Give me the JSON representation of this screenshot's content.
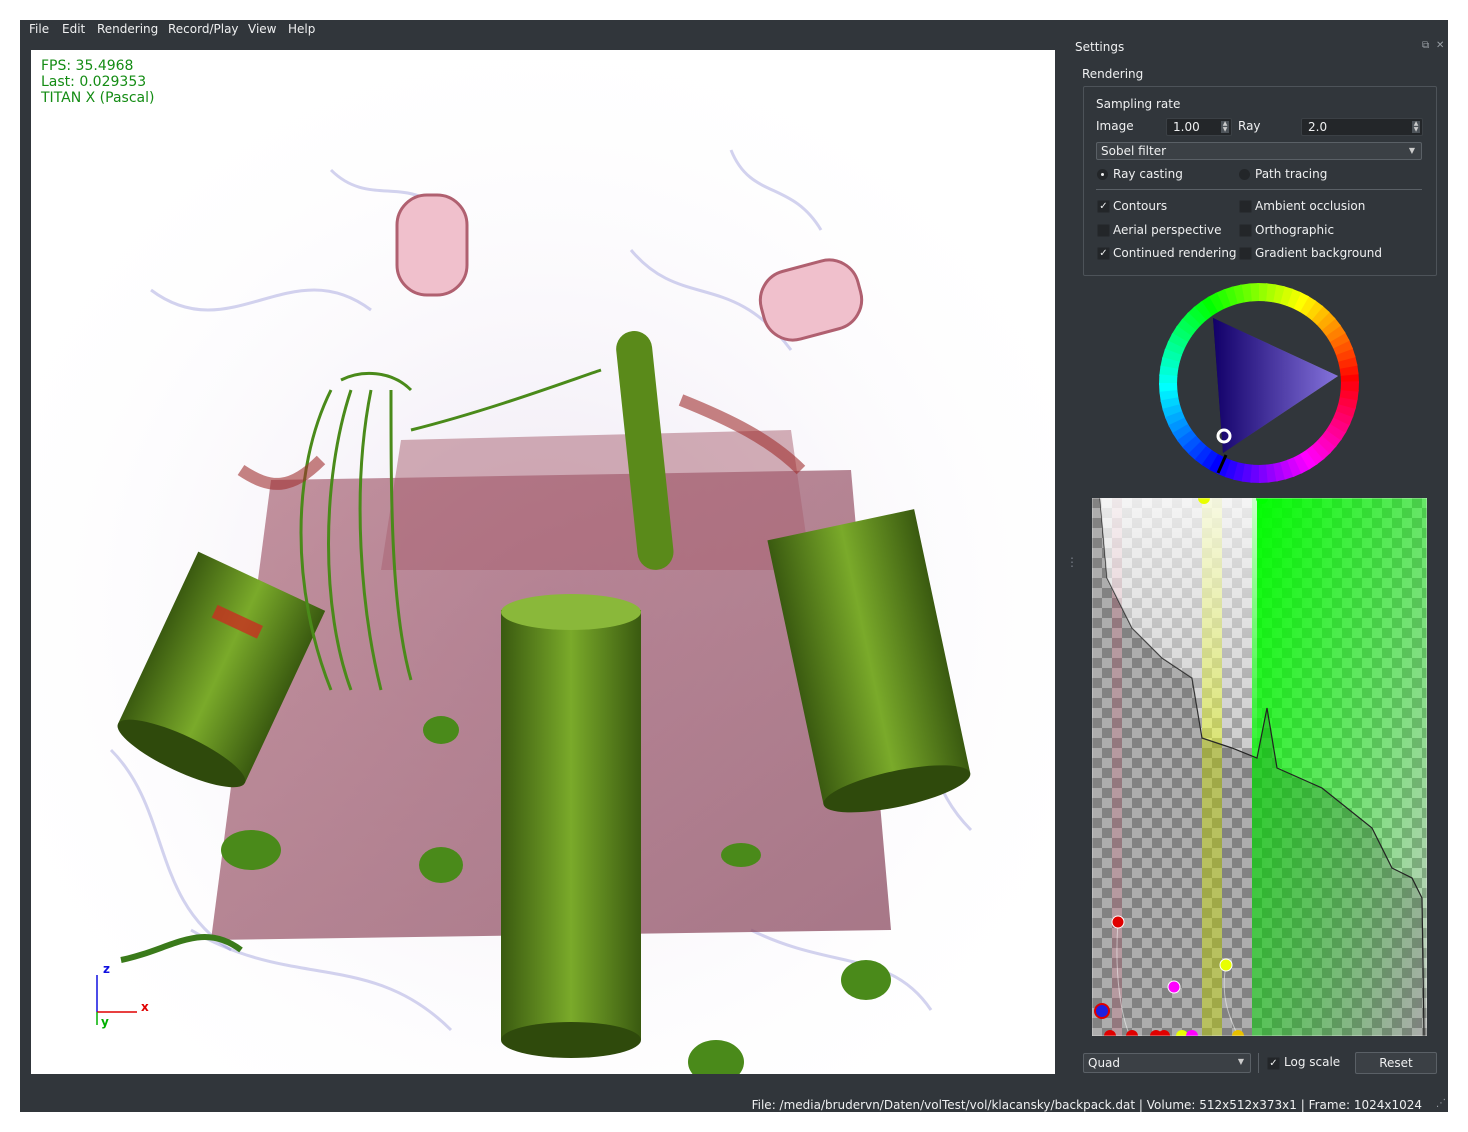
{
  "menu": [
    "File",
    "Edit",
    "Rendering",
    "Record/Play",
    "View",
    "Help"
  ],
  "overlay": {
    "fps": "FPS: 35.4968",
    "last": "Last: 0.029353",
    "gpu": "TITAN X (Pascal)"
  },
  "axes": {
    "x": "x",
    "y": "y",
    "z": "z",
    "x_color": "#e00000",
    "y_color": "#00b000",
    "z_color": "#1010e0"
  },
  "settings": {
    "title": "Settings",
    "section": "Rendering",
    "sampling_rate": "Sampling rate",
    "image_label": "Image",
    "image_value": "1.00",
    "ray_label": "Ray",
    "ray_value": "2.0",
    "filter": "Sobel filter",
    "ray_casting": "Ray casting",
    "path_tracing": "Path tracing",
    "render_mode": "Ray casting",
    "options": [
      {
        "label": "Contours",
        "checked": true
      },
      {
        "label": "Ambient occlusion",
        "checked": false
      },
      {
        "label": "Aerial perspective",
        "checked": false
      },
      {
        "label": "Orthographic",
        "checked": false
      },
      {
        "label": "Continued rendering",
        "checked": true
      },
      {
        "label": "Gradient background",
        "checked": false
      }
    ]
  },
  "transfer_function": {
    "interpolation": "Quad",
    "log_scale_label": "Log scale",
    "log_scale": true,
    "reset": "Reset"
  },
  "status": "File: /media/brudervn/Daten/volTest/vol/klacansky/backpack.dat | Volume: 512x512x373x1 | Frame: 1024x1024",
  "colors": {
    "bg": "#31363b",
    "overlay_text": "#148c14",
    "accent": "#3daee9"
  }
}
